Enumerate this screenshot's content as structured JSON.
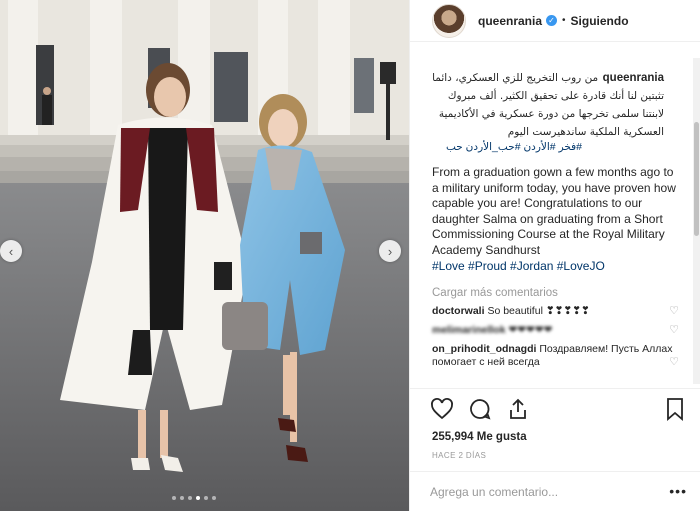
{
  "post": {
    "slide_count": 6,
    "active_slide": 4,
    "prev_arrow": "‹",
    "next_arrow": "›"
  },
  "header": {
    "username": "queenrania",
    "verified_mark": "✓",
    "separator": "•",
    "follow_state": "Siguiendo"
  },
  "caption": {
    "username": "queenrania",
    "arabic_text": "من روب التخريج للزي العسكري، دائما تثبتين لنا أنك قادرة على تحقيق الكثير. ألف مبروك لابنتنا سلمى تخرجها من دورة عسكرية في الأكاديمية العسكرية الملكية ساندهيرست اليوم",
    "arabic_tags": "#فخر #الأردن #حب_الأردن حب",
    "english_text": "From a graduation gown a few months ago to a military uniform today, you have proven how capable you are! Congratulations to our daughter Salma on graduating from a Short Commissioning Course at the Royal Military Academy Sandhurst",
    "hashtags": "#Love #Proud #Jordan #LoveJO"
  },
  "load_more_label": "Cargar más comentarios",
  "comments": [
    {
      "user": "doctorwali",
      "text": "So beautiful ❣❣❣❣❣"
    },
    {
      "user": "melimarinellok",
      "text": "❤❤❤❤❤"
    },
    {
      "user": "on_prihodit_odnagdi",
      "text": "Поздравляем! Пусть Аллах помогает с ней всегда"
    }
  ],
  "actions": {
    "likes": "255,994 Me gusta",
    "timestamp": "HACE 2 DÍAS",
    "comment_placeholder": "Agrega un comentario...",
    "more_options": "•••"
  },
  "icons": [
    "heart-icon",
    "comment-icon",
    "share-icon",
    "bookmark-icon",
    "verified-icon"
  ],
  "colors": {
    "accent_blue": "#3897f0",
    "hashtag_blue": "#003569",
    "muted_gray": "#999999",
    "border": "#efefef"
  }
}
